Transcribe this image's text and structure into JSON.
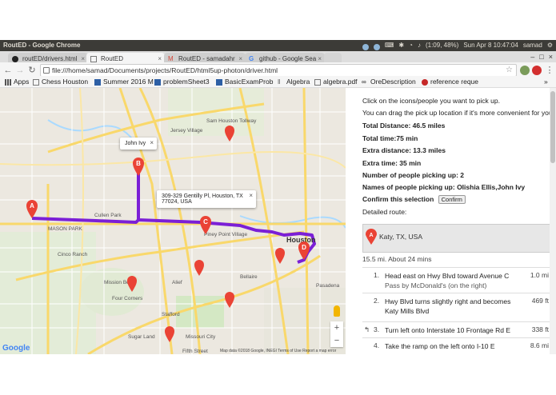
{
  "os": {
    "window_title": "RoutED - Google Chrome",
    "status": "(1:09, 48%)",
    "datetime": "Sun Apr  8 10:47:04",
    "user": "samad"
  },
  "tabs": [
    {
      "label": "routED/drivers.html"
    },
    {
      "label": "RoutED"
    },
    {
      "label": "RoutED - samadahr"
    },
    {
      "label": "github - Google Sea"
    }
  ],
  "address": {
    "url": "file:///home/samad/Documents/projects/RoutED/html5up-photon/driver.html"
  },
  "bookmarks": [
    {
      "label": "Apps"
    },
    {
      "label": "Chess Houston"
    },
    {
      "label": "Summer 2016 M"
    },
    {
      "label": "problemSheet3"
    },
    {
      "label": "BasicExamProb"
    },
    {
      "label": "Algebra"
    },
    {
      "label": "algebra.pdf"
    },
    {
      "label": "OreDescription"
    },
    {
      "label": "reference reque"
    }
  ],
  "map": {
    "infowindow_b": "John Ivy",
    "infowindow_c": "309-329 Gentilly Pl, Houston, TX 77024, USA",
    "markers": [
      "A",
      "B",
      "C",
      "D"
    ],
    "places": {
      "cullen_park": "Cullen Park",
      "mason_park": "MASON PARK",
      "cinco_ranch": "Cinco Ranch",
      "mission_bend": "Mission Bend",
      "four_corners": "Four Corners",
      "sugar_land": "Sugar Land",
      "missouri_city": "Missouri City",
      "houston": "Houston",
      "piney_point": "Piney Point Village",
      "jersey_village": "Jersey Village",
      "bellaire": "Bellaire",
      "fifth_street": "Fifth Street",
      "alief": "Alief",
      "sam_houston": "Sam Houston Tollway",
      "stafford": "Stafford",
      "pasadena": "Pasadena"
    },
    "footer": "Map data ©2018 Google, INEGI   Terms of Use   Report a map error",
    "logo": "Google"
  },
  "panel": {
    "instruction1": "Click on the icons/people you want to pick up.",
    "instruction2": "You can drag the pick up location if it's more convenient for you.",
    "total_distance": "Total Distance: 46.5 miles",
    "total_time": "Total time:75 min",
    "extra_distance": "Extra distance: 13.3 miles",
    "extra_time": "Extra time: 35 min",
    "num_people": "Number of people picking up: 2",
    "names": "Names of people picking up: Olishia Ellis,John Ivy",
    "confirm_label": "Confirm this selection",
    "confirm_button": "Confirm",
    "detailed_route": "Detailed route:",
    "start_address": "Katy, TX, USA",
    "summary": "15.5 mi. About 24 mins",
    "steps": [
      {
        "num": "1.",
        "text": "Head east on Hwy Blvd toward Avenue C",
        "sub": "Pass by McDonald's (on the right)",
        "dist": "1.0 mi"
      },
      {
        "num": "2.",
        "text": "Hwy Blvd turns slightly right and becomes Katy Mills Blvd",
        "sub": "",
        "dist": "469 ft"
      },
      {
        "num": "3.",
        "text": "Turn left onto Interstate 10 Frontage Rd E",
        "sub": "",
        "dist": "338 ft"
      },
      {
        "num": "4.",
        "text": "Take the ramp on the left onto I-10 E",
        "sub": "",
        "dist": "8.6 mi"
      }
    ]
  },
  "colors": {
    "route": "#7b1fd6",
    "marker": "#ea4335",
    "highway": "#f9d86b",
    "water": "#aadaff"
  }
}
